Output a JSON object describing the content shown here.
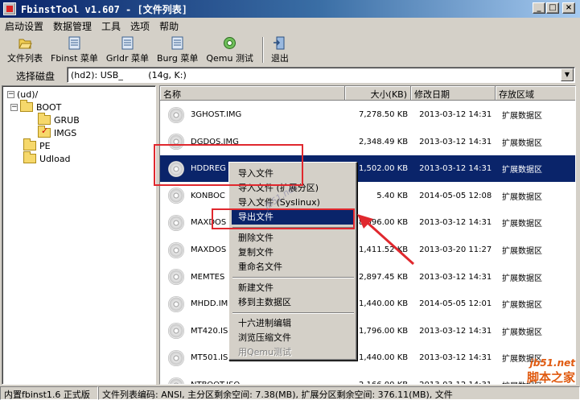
{
  "window": {
    "title": "FbinstTool v1.607 - [文件列表]"
  },
  "menu": [
    "启动设置",
    "数据管理",
    "工具",
    "选项",
    "帮助"
  ],
  "toolbar": [
    {
      "label": "文件列表",
      "icon": "open-folder-icon"
    },
    {
      "label": "Fbinst 菜单",
      "icon": "menu-doc-icon"
    },
    {
      "label": "Grldr 菜单",
      "icon": "menu-doc-icon"
    },
    {
      "label": "Burg 菜单",
      "icon": "menu-doc-icon"
    },
    {
      "label": "Qemu 测试",
      "icon": "qemu-icon"
    },
    {
      "label": "退出",
      "icon": "exit-door-icon"
    }
  ],
  "disk_select": {
    "label": "选择磁盘",
    "value": "(hd2): USB_         (14g, K:)"
  },
  "tree": [
    {
      "label": "(ud)/",
      "level": 0,
      "toggle": "−"
    },
    {
      "label": "BOOT",
      "level": 1,
      "toggle": "−"
    },
    {
      "label": "GRUB",
      "level": 2,
      "toggle": ""
    },
    {
      "label": "IMGS",
      "level": 2,
      "toggle": ""
    },
    {
      "label": "PE",
      "level": 1,
      "toggle": ""
    },
    {
      "label": "Udload",
      "level": 1,
      "toggle": ""
    }
  ],
  "columns": [
    "名称",
    "大小(KB)",
    "修改日期",
    "存放区域"
  ],
  "files": [
    {
      "name": "3GHOST.IMG",
      "size": "7,278.50 KB",
      "date": "2013-03-12 14:31",
      "area": "扩展数据区"
    },
    {
      "name": "DGDOS.IMG",
      "size": "2,348.49 KB",
      "date": "2013-03-12 14:31",
      "area": "扩展数据区"
    },
    {
      "name": "HDDREG",
      "size": "1,502.00 KB",
      "date": "2013-03-12 14:31",
      "area": "扩展数据区"
    },
    {
      "name": "KONBOC",
      "size": "5.40 KB",
      "date": "2014-05-05 12:08",
      "area": "扩展数据区"
    },
    {
      "name": "MAXDOS",
      "size": "8,096.00 KB",
      "date": "2013-03-12 14:31",
      "area": "扩展数据区"
    },
    {
      "name": "MAXDOS",
      "size": "1,411.52 KB",
      "date": "2013-03-20 11:27",
      "area": "扩展数据区"
    },
    {
      "name": "MEMTES",
      "size": "2,897.45 KB",
      "date": "2013-03-12 14:31",
      "area": "扩展数据区"
    },
    {
      "name": "MHDD.IM",
      "size": "1,440.00 KB",
      "date": "2014-05-05 12:01",
      "area": "扩展数据区"
    },
    {
      "name": "MT420.IS",
      "size": "1,796.00 KB",
      "date": "2013-03-12 14:31",
      "area": "扩展数据区"
    },
    {
      "name": "MT501.IS",
      "size": "1,440.00 KB",
      "date": "2013-03-12 14:31",
      "area": "扩展数据区"
    },
    {
      "name": "NTBOOT.ISO",
      "size": "2,166.00 KB",
      "date": "2013-03-12 14:31",
      "area": "扩展数据区"
    }
  ],
  "context_menu": {
    "groups": [
      [
        "导入文件",
        "导入文件 (扩展分区)",
        "导入文件 (Syslinux)",
        "导出文件"
      ],
      [
        "删除文件",
        "复制文件",
        "重命名文件"
      ],
      [
        "新建文件",
        "移到主数据区"
      ],
      [
        "十六进制编辑",
        "浏览压缩文件",
        "用Qemu测试"
      ]
    ],
    "highlighted": "导出文件",
    "disabled": "用Qemu测试"
  },
  "statusbar": [
    "内置fbinst1.6 正式版",
    "文件列表编码: ANSI, 主分区剩余空间: 7.38(MB), 扩展分区剩余空间: 376.11(MB), 文件"
  ],
  "watermark": {
    "site": "jb51.net",
    "name": "脚本之家"
  },
  "colors": {
    "selection": "#0a246a",
    "annotation": "#e0282e"
  }
}
